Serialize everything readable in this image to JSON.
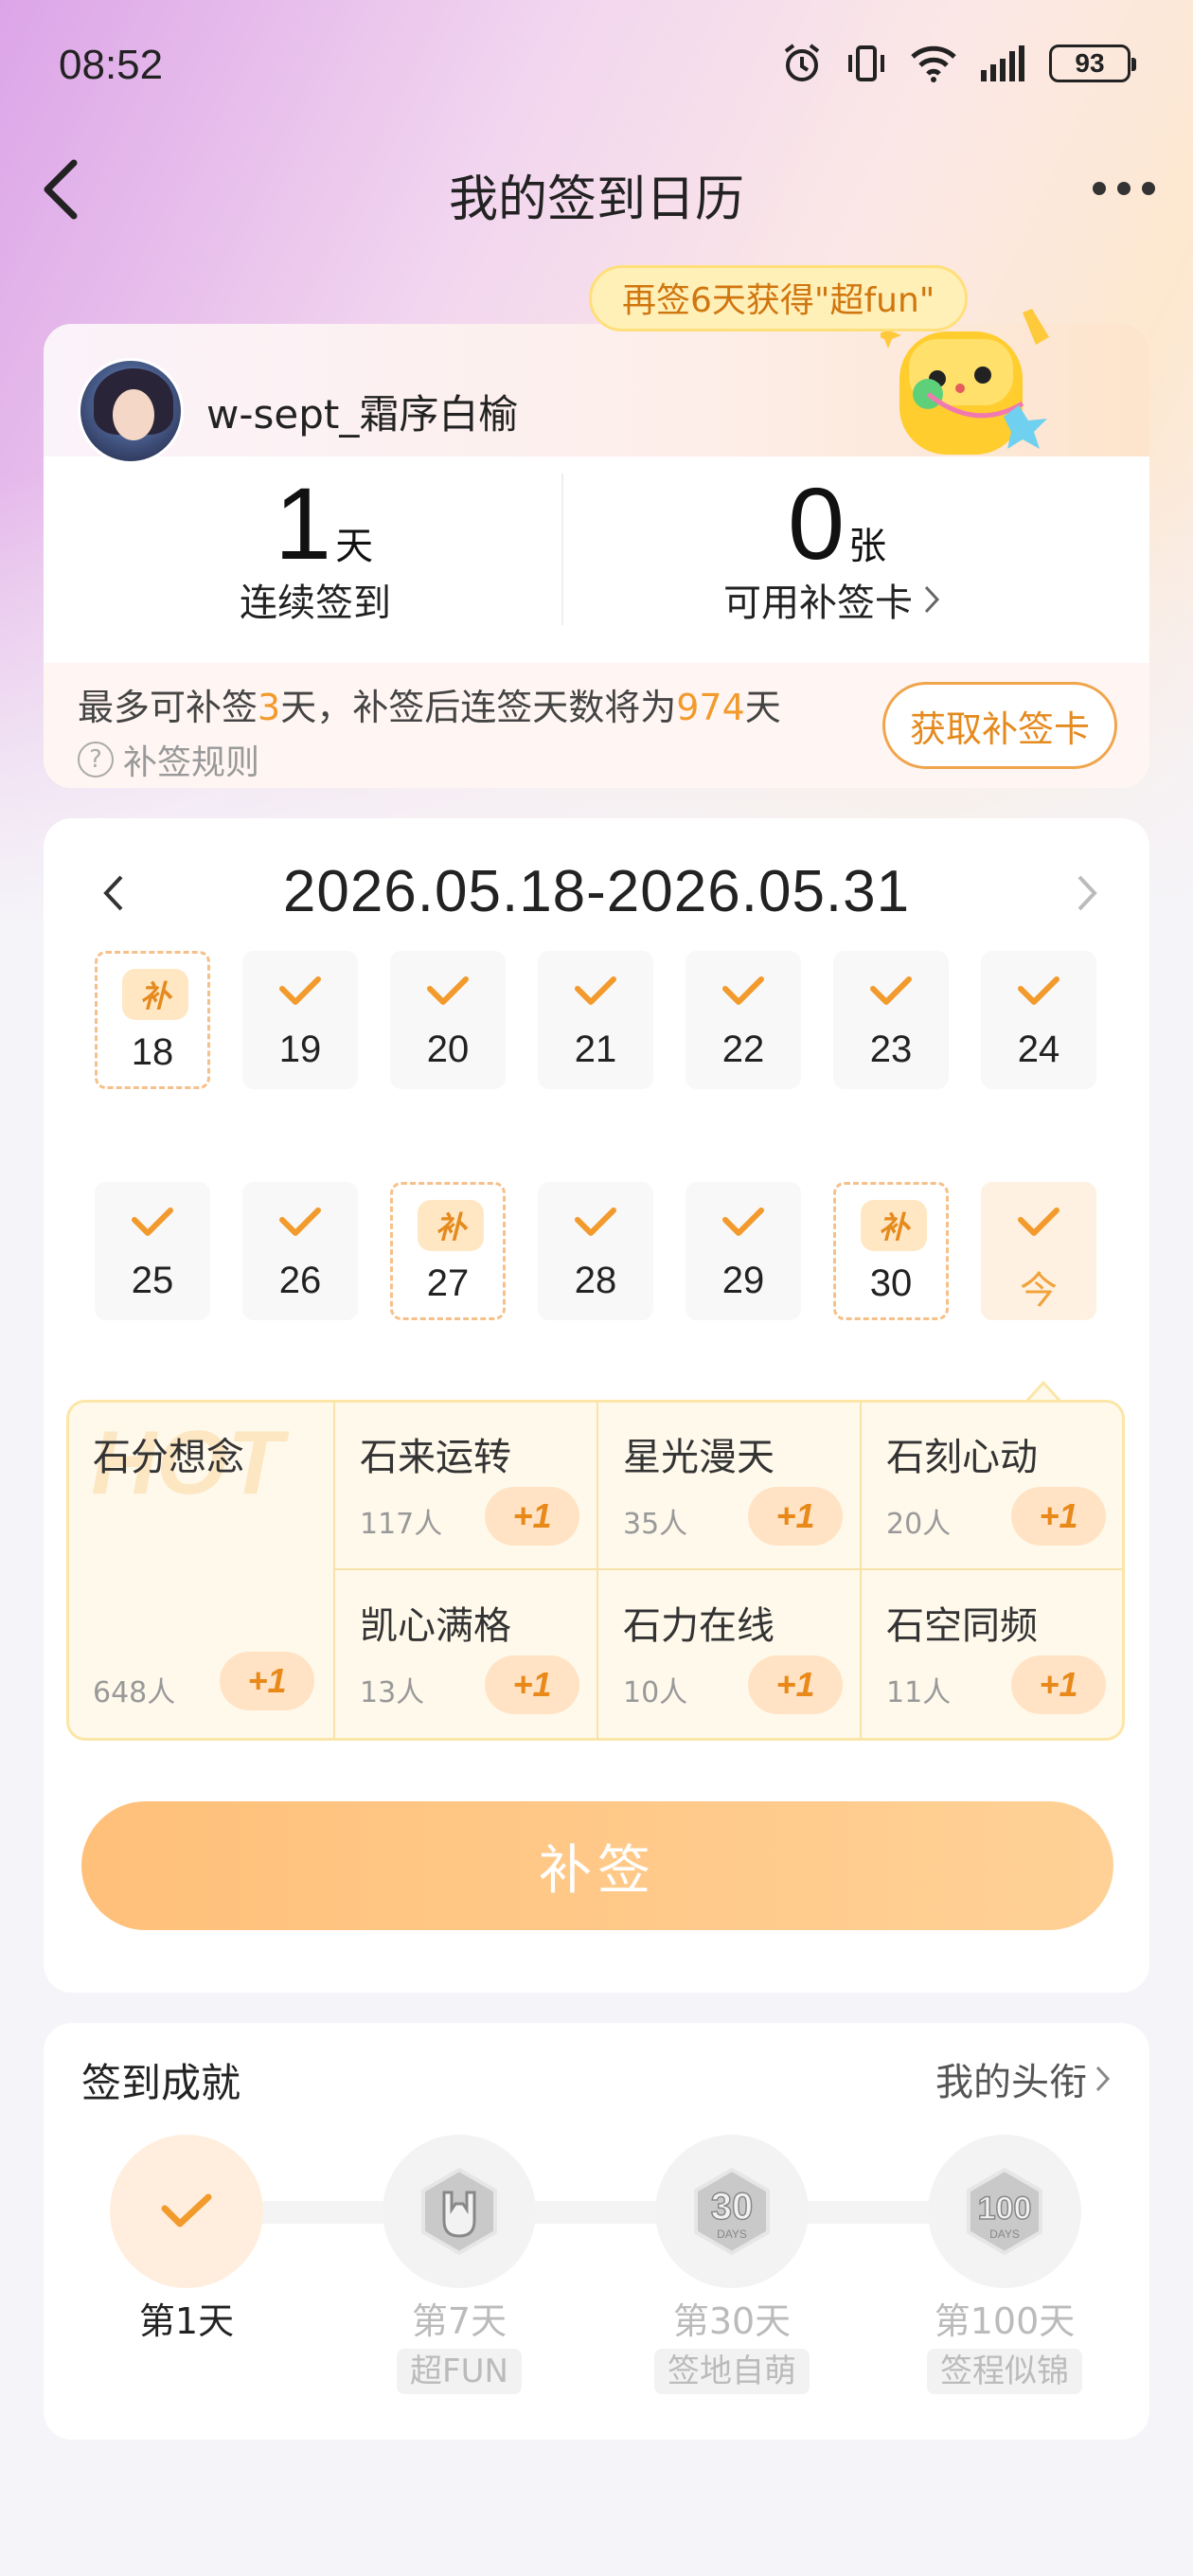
{
  "status_bar": {
    "time": "08:52",
    "battery": "93"
  },
  "nav": {
    "title": "我的签到日历"
  },
  "user": {
    "name": "w-sept_霜序白榆",
    "tip": "再签6天获得\"超fun\"",
    "streak_num": "1",
    "streak_unit": "天",
    "streak_label": "连续签到",
    "cards_num": "0",
    "cards_unit": "张",
    "cards_label": "可用补签卡",
    "info_prefix": "最多可补签",
    "info_days": "3",
    "info_mid": "天，补签后连签天数将为",
    "info_total": "974",
    "info_suffix": "天",
    "rule_label": "补签规则",
    "get_card_label": "获取补签卡"
  },
  "calendar": {
    "range": "2026.05.18-2026.05.31",
    "bu_tag": "补",
    "days": [
      {
        "num": "18",
        "state": "bu"
      },
      {
        "num": "19",
        "state": "checked"
      },
      {
        "num": "20",
        "state": "checked"
      },
      {
        "num": "21",
        "state": "checked"
      },
      {
        "num": "22",
        "state": "checked"
      },
      {
        "num": "23",
        "state": "checked"
      },
      {
        "num": "24",
        "state": "checked"
      },
      {
        "num": "25",
        "state": "checked"
      },
      {
        "num": "26",
        "state": "checked"
      },
      {
        "num": "27",
        "state": "bu"
      },
      {
        "num": "28",
        "state": "checked"
      },
      {
        "num": "29",
        "state": "checked"
      },
      {
        "num": "30",
        "state": "bu"
      },
      {
        "num": "今",
        "state": "today"
      }
    ]
  },
  "stones": {
    "watermark": "HOT",
    "plus_label": "+1",
    "featured": {
      "name": "石分想念",
      "count": "648人"
    },
    "items": [
      {
        "name": "石来运转",
        "count": "117人"
      },
      {
        "name": "星光漫天",
        "count": "35人"
      },
      {
        "name": "石刻心动",
        "count": "20人"
      },
      {
        "name": "凯心满格",
        "count": "13人"
      },
      {
        "name": "石力在线",
        "count": "10人"
      },
      {
        "name": "石空同频",
        "count": "11人"
      }
    ]
  },
  "bq_button": "补签",
  "achievements": {
    "title": "签到成就",
    "link": "我的头衔",
    "items": [
      {
        "day": "第1天",
        "tag": "",
        "done": true
      },
      {
        "day": "第7天",
        "tag": "超FUN",
        "done": false
      },
      {
        "day": "第30天",
        "tag": "签地自萌",
        "done": false
      },
      {
        "day": "第100天",
        "tag": "签程似锦",
        "done": false
      }
    ]
  },
  "colors": {
    "accent": "#f0a33b",
    "button": "#ffc07a",
    "tip_bg": "#fff0b8"
  }
}
